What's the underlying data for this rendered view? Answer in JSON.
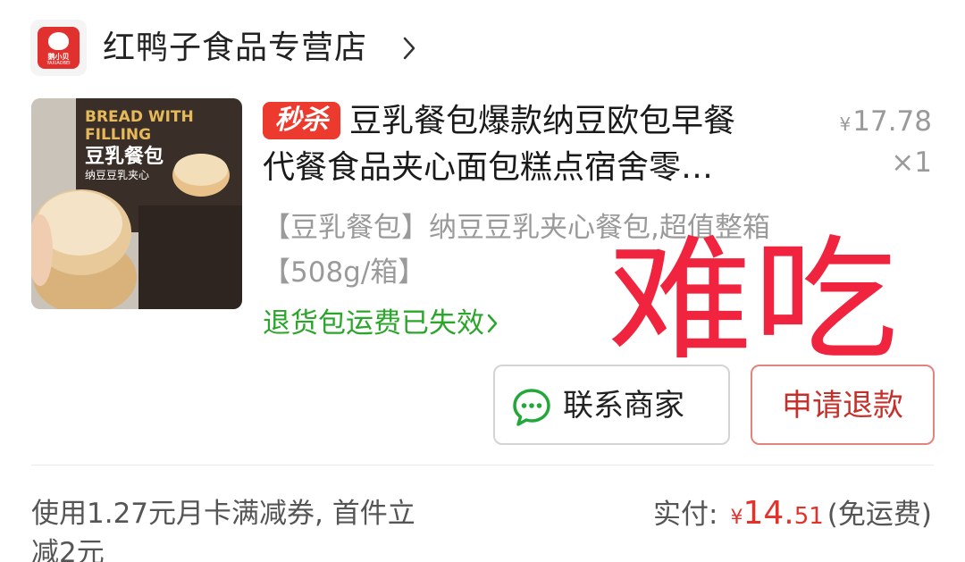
{
  "store": {
    "name": "红鸭子食品专营店",
    "logo_text": "鹅小贝",
    "logo_subtext": "YAXIAOBEI"
  },
  "product": {
    "badge": "秒杀",
    "title_line1": "豆乳餐包爆款纳豆欧包早餐",
    "title_line2": "代餐食品夹心面包糕点宿舍零…",
    "price_symbol": "¥",
    "price": "17.78",
    "quantity": "×1",
    "spec": "【豆乳餐包】纳豆豆乳夹心餐包,超值整箱【508g/箱】",
    "return_shipping": "退货包运费已失效",
    "image_text": {
      "line1": "BREAD WITH",
      "line2": "FILLING",
      "title": "豆乳餐包",
      "subtitle": "纳豆豆乳夹心"
    }
  },
  "annotation": "难吃",
  "actions": {
    "contact": "联系商家",
    "refund": "申请退款"
  },
  "footer": {
    "coupon": "使用1.27元月卡满减券, 首件立减2元",
    "paid_label": "实付:",
    "paid_symbol": "¥",
    "paid_int": "14.",
    "paid_dec": "51",
    "shipping": "(免运费)"
  },
  "colors": {
    "accent_red": "#e4322b",
    "return_green": "#2ba62b",
    "badge_red": "#ec3b2e"
  }
}
